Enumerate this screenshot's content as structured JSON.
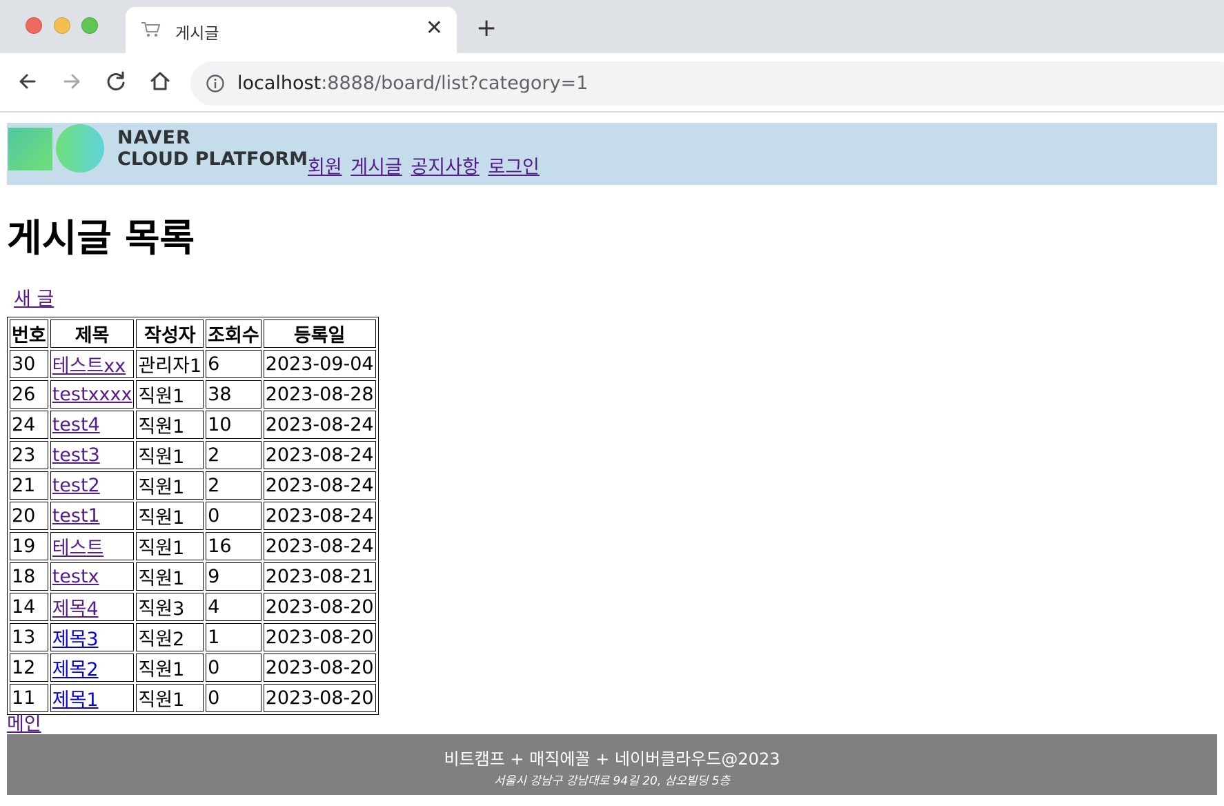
{
  "browser": {
    "tab_title": "게시글",
    "url_host": "localhost",
    "url_rest": ":8888/board/list?category=1"
  },
  "header": {
    "logo_line1": "NAVER",
    "logo_line2": "CLOUD PLATFORM",
    "menu": [
      "회원",
      "게시글",
      "공지사항",
      "로그인"
    ]
  },
  "main": {
    "title": "게시글 목록",
    "new_post_label": "새 글",
    "table": {
      "columns": [
        "번호",
        "제목",
        "작성자",
        "조회수",
        "등록일"
      ],
      "rows": [
        {
          "no": "30",
          "title": "테스트xx",
          "writer": "관리자1",
          "views": "6",
          "date": "2023-09-04",
          "visited": true
        },
        {
          "no": "26",
          "title": "testxxxx",
          "writer": "직원1",
          "views": "38",
          "date": "2023-08-28",
          "visited": true
        },
        {
          "no": "24",
          "title": "test4",
          "writer": "직원1",
          "views": "10",
          "date": "2023-08-24",
          "visited": true
        },
        {
          "no": "23",
          "title": "test3",
          "writer": "직원1",
          "views": "2",
          "date": "2023-08-24",
          "visited": true
        },
        {
          "no": "21",
          "title": "test2",
          "writer": "직원1",
          "views": "2",
          "date": "2023-08-24",
          "visited": true
        },
        {
          "no": "20",
          "title": "test1",
          "writer": "직원1",
          "views": "0",
          "date": "2023-08-24",
          "visited": true
        },
        {
          "no": "19",
          "title": "테스트",
          "writer": "직원1",
          "views": "16",
          "date": "2023-08-24",
          "visited": true
        },
        {
          "no": "18",
          "title": "testx",
          "writer": "직원1",
          "views": "9",
          "date": "2023-08-21",
          "visited": true
        },
        {
          "no": "14",
          "title": "제목4",
          "writer": "직원3",
          "views": "4",
          "date": "2023-08-20",
          "visited": true
        },
        {
          "no": "13",
          "title": "제목3",
          "writer": "직원2",
          "views": "1",
          "date": "2023-08-20",
          "visited": false
        },
        {
          "no": "12",
          "title": "제목2",
          "writer": "직원1",
          "views": "0",
          "date": "2023-08-20",
          "visited": false
        },
        {
          "no": "11",
          "title": "제목1",
          "writer": "직원1",
          "views": "0",
          "date": "2023-08-20",
          "visited": false
        }
      ]
    },
    "main_link_label": "메인"
  },
  "footer": {
    "line1": "비트캠프 + 매직에꼴 + 네이버클라우드@2023",
    "line2": "서울시 강남구 강남대로 94길 20, 삼오빌딩 5층"
  },
  "colors": {
    "visited_link": "#551a8b",
    "unvisited_link": "#0000ee",
    "header_bg": "#c5dceb",
    "footer_bg": "#808080"
  }
}
